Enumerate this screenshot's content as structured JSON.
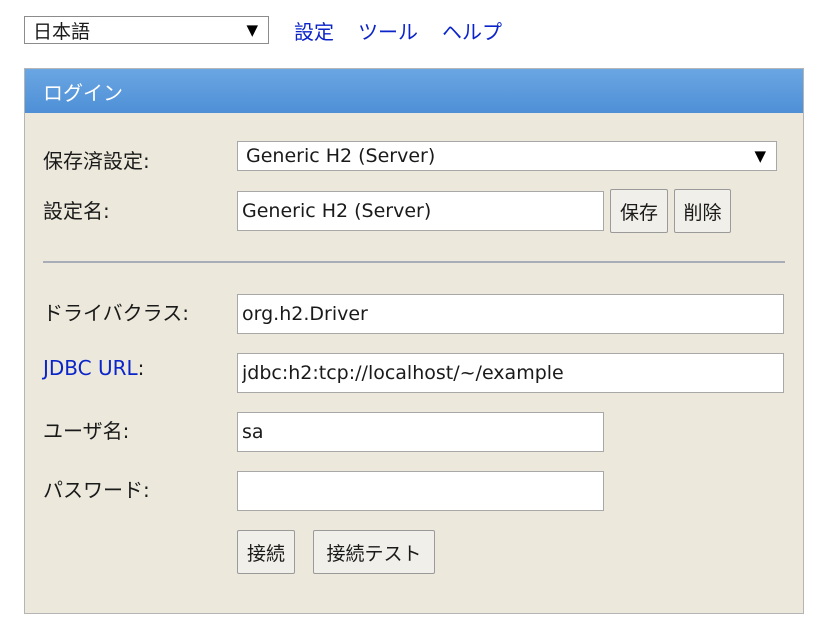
{
  "topbar": {
    "language": "日本語",
    "links": {
      "settings": "設定",
      "tools": "ツール",
      "help": "ヘルプ"
    }
  },
  "login": {
    "title": "ログイン",
    "saved_settings_label": "保存済設定:",
    "saved_settings_value": "Generic H2 (Server)",
    "setting_name_label": "設定名:",
    "setting_name_value": "Generic H2 (Server)",
    "save_button": "保存",
    "delete_button": "削除",
    "driver_class_label": "ドライバクラス:",
    "driver_class_value": "org.h2.Driver",
    "jdbc_url_label": "JDBC URL",
    "jdbc_url_colon": ":",
    "jdbc_url_value": "jdbc:h2:tcp://localhost/~/example",
    "username_label": "ユーザ名:",
    "username_value": "sa",
    "password_label": "パスワード:",
    "password_value": "",
    "connect_button": "接続",
    "test_connection_button": "接続テスト"
  },
  "icons": {
    "dropdown": "chevron-down-icon"
  }
}
